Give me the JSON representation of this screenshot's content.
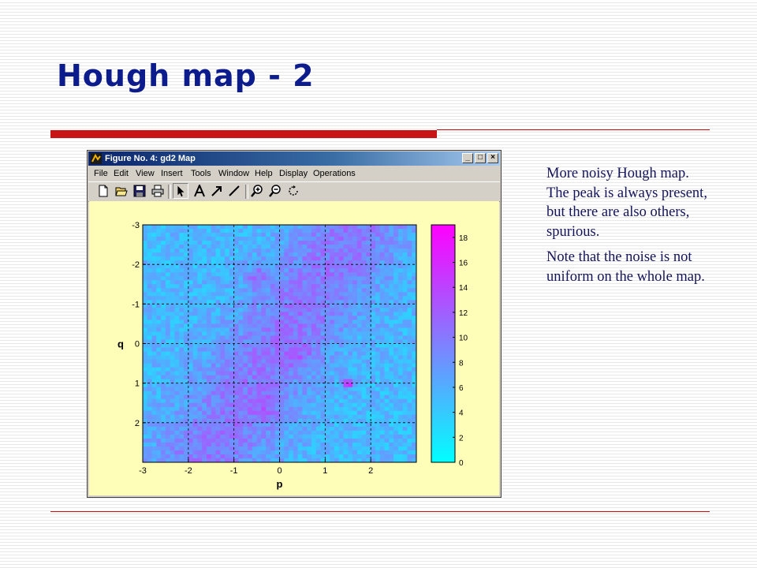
{
  "slide": {
    "title": "Hough map - 2",
    "paragraphs": [
      "More noisy Hough map. The peak is always present, but there are also others, spurious.",
      "Note that the noise is not uniform on the whole map."
    ]
  },
  "window": {
    "title": "Figure No. 4: gd2 Map",
    "buttons": {
      "minimize": "_",
      "maximize": "□",
      "close": "×"
    },
    "menu": [
      "File",
      "Edit",
      "View",
      "Insert",
      "Tools",
      "Window",
      "Help",
      "Display",
      "Operations"
    ],
    "toolbar_icons": [
      "new-file-icon",
      "open-folder-icon",
      "save-icon",
      "print-icon",
      "select-arrow-icon",
      "text-insert-icon",
      "arrow-insert-icon",
      "line-insert-icon",
      "zoom-in-icon",
      "zoom-out-icon",
      "rotate-icon"
    ]
  },
  "colors": {
    "title": "#0c1c8c",
    "accent_rule": "#c81414",
    "colormap_low": "#00ffff",
    "colormap_high": "#ff00ff",
    "plot_background": "#fefeb8"
  },
  "chart_data": {
    "type": "heatmap",
    "xlabel": "p",
    "ylabel": "q",
    "xlim": [
      -3,
      3
    ],
    "ylim": [
      -3,
      3
    ],
    "y_reversed": true,
    "x_ticks": [
      "-3",
      "-2",
      "-1",
      "0",
      "1",
      "2"
    ],
    "y_ticks": [
      "-3",
      "-2",
      "-1",
      "0",
      "1",
      "2"
    ],
    "grid": true,
    "colorbar": {
      "min": 0,
      "max": 19,
      "ticks": [
        "0",
        "2",
        "4",
        "6",
        "8",
        "10",
        "12",
        "14",
        "16",
        "18"
      ]
    },
    "peak": {
      "p": 1.5,
      "q": 1.0,
      "value": 19
    },
    "secondary_hotspots": [
      {
        "p": -0.5,
        "q": -1.7,
        "value": 13
      },
      {
        "p": 0.4,
        "q": 0.3,
        "value": 12
      },
      {
        "p": -0.3,
        "q": 1.6,
        "value": 12
      }
    ]
  }
}
